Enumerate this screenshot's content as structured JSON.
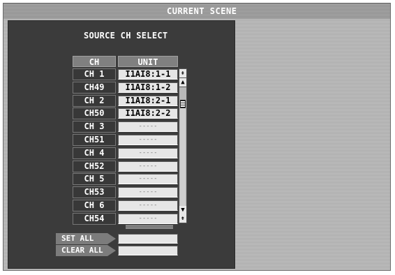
{
  "scene_title": "CURRENT SCENE",
  "panel_title": "SOURCE CH SELECT",
  "table": {
    "col_ch": "CH",
    "col_unit": "UNIT",
    "rows": [
      {
        "ch": "CH 1",
        "unit": "I1AI8:1-1"
      },
      {
        "ch": "CH49",
        "unit": "I1AI8:1-2"
      },
      {
        "ch": "CH 2",
        "unit": "I1AI8:2-1"
      },
      {
        "ch": "CH50",
        "unit": "I1AI8:2-2"
      },
      {
        "ch": "CH 3",
        "unit": "-----"
      },
      {
        "ch": "CH51",
        "unit": "-----"
      },
      {
        "ch": "CH 4",
        "unit": "-----"
      },
      {
        "ch": "CH52",
        "unit": "-----"
      },
      {
        "ch": "CH 5",
        "unit": "-----"
      },
      {
        "ch": "CH53",
        "unit": "-----"
      },
      {
        "ch": "CH 6",
        "unit": "-----"
      },
      {
        "ch": "CH54",
        "unit": "-----"
      }
    ]
  },
  "actions": {
    "set_all": "SET ALL",
    "clear_all": "CLEAR ALL"
  },
  "icons": {
    "scroll_top": "scroll-top-icon",
    "scroll_up": "scroll-up-icon",
    "scroll_down": "scroll-down-icon"
  }
}
